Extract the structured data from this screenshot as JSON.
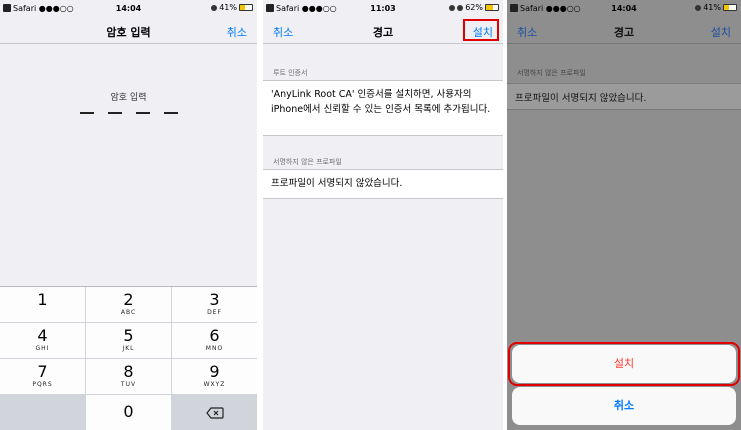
{
  "screen1": {
    "status": {
      "carrier": "Safari ●●●○○",
      "time": "14:04",
      "battery": "41%"
    },
    "nav": {
      "title": "암호 입력",
      "right": "취소"
    },
    "passcode_label": "암호 입력",
    "keys": [
      {
        "digit": "1",
        "letters": ""
      },
      {
        "digit": "2",
        "letters": "ABC"
      },
      {
        "digit": "3",
        "letters": "DEF"
      },
      {
        "digit": "4",
        "letters": "GHI"
      },
      {
        "digit": "5",
        "letters": "JKL"
      },
      {
        "digit": "6",
        "letters": "MNO"
      },
      {
        "digit": "7",
        "letters": "PQRS"
      },
      {
        "digit": "8",
        "letters": "TUV"
      },
      {
        "digit": "9",
        "letters": "WXYZ"
      },
      {
        "digit": "0",
        "letters": ""
      }
    ]
  },
  "screen2": {
    "status": {
      "carrier": "Safari ●●●○○",
      "time": "11:03",
      "battery": "62%"
    },
    "nav": {
      "left": "취소",
      "title": "경고",
      "right": "설치"
    },
    "root_header": "루트 인증서",
    "root_text": "'AnyLink Root CA' 인증서를 설치하면, 사용자의 iPhone에서 신뢰할 수 있는 인증서 목록에 추가됩니다.",
    "unsigned_header": "서명하지 않은 프로파일",
    "unsigned_text": "프로파일이 서명되지 않았습니다."
  },
  "screen3": {
    "status": {
      "carrier": "Safari ●●●○○",
      "time": "14:04",
      "battery": "41%"
    },
    "nav": {
      "left": "취소",
      "title": "경고",
      "right": "설치"
    },
    "unsigned_header": "서명하지 않은 프로파일",
    "unsigned_text": "프로파일이 서명되지 않았습니다.",
    "sheet_install": "설치",
    "sheet_cancel": "취소"
  },
  "colors": {
    "ios_blue": "#007aff",
    "destructive_red": "#ff3b30",
    "highlight_red": "#e00000"
  }
}
